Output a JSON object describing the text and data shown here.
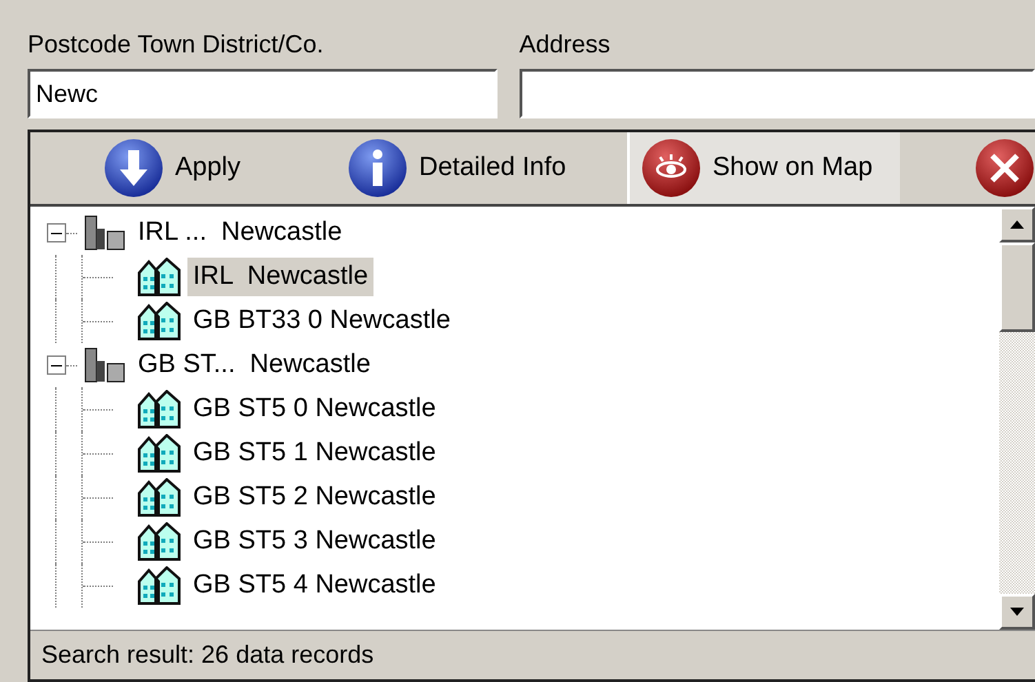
{
  "fields": [
    {
      "label": "Postcode Town District/Co.",
      "value": "Newc"
    },
    {
      "label": "Address"
    }
  ],
  "toolbar": [
    {
      "kind": "apply",
      "label": "Apply",
      "selected": false
    },
    {
      "kind": "info",
      "label": "Detailed Info",
      "selected": false
    },
    {
      "kind": "map",
      "label": "Show on Map",
      "selected": true
    },
    {
      "kind": "close",
      "selected": false
    }
  ],
  "tree": [
    {
      "label": "IRL ...  Newcastle",
      "expanded": true,
      "children": [
        {
          "label": "IRL  Newcastle",
          "selected": true
        },
        {
          "label": "GB BT33 0 Newcastle",
          "selected": false
        }
      ]
    },
    {
      "label": "GB ST...  Newcastle",
      "expanded": true,
      "children": [
        {
          "label": "GB ST5 0 Newcastle",
          "selected": false
        },
        {
          "label": "GB ST5 1 Newcastle",
          "selected": false
        },
        {
          "label": "GB ST5 2 Newcastle",
          "selected": false
        },
        {
          "label": "GB ST5 3 Newcastle",
          "selected": false
        },
        {
          "label": "GB ST5 4 Newcastle",
          "selected": false
        }
      ]
    }
  ],
  "status_bar": "Search result: 26 data records"
}
